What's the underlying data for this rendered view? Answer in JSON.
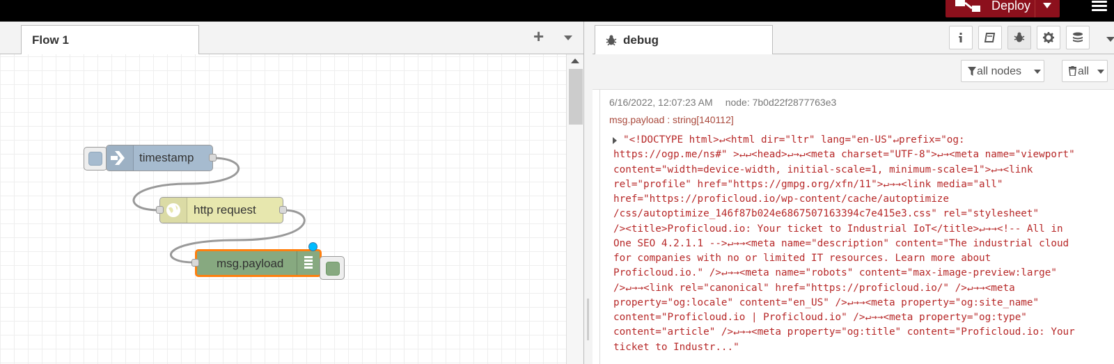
{
  "header": {
    "deploy_label": "Deploy",
    "brand_color": "#8c101c"
  },
  "workspace": {
    "tab_label": "Flow 1",
    "add_symbol": "+",
    "nodes": [
      {
        "label": "timestamp",
        "color": "#a6bbcf",
        "icon": "inject-arrow-icon"
      },
      {
        "label": "http request",
        "color": "#e7e7ae",
        "icon": "globe-icon"
      },
      {
        "label": "msg.payload",
        "color": "#87a980",
        "icon": "debug-list-icon"
      }
    ]
  },
  "sidebar": {
    "tab_label": "debug",
    "tab_icon": "bug-icon",
    "buttons": [
      "info-icon",
      "book-icon",
      "bug-icon",
      "gear-icon",
      "database-icon"
    ],
    "filter_label": "all nodes",
    "clear_label": "all"
  },
  "debug_message": {
    "timestamp": "6/16/2022, 12:07:23 AM",
    "node": "node: 7b0d22f2877763e3",
    "topic": "msg.payload : string[140112]",
    "body_lines": [
      "\"<!DOCTYPE html>↵<html dir=\"ltr\" lang=\"en-US\"↵prefix=\"og:",
      "https://ogp.me/ns#\" >↵↵<head>↵→↵<meta charset=\"UTF-8\">↵→<meta name=\"viewport\"",
      "content=\"width=device-width, initial-scale=1, minimum-scale=1\">↵→<link",
      "rel=\"profile\" href=\"https://gmpg.org/xfn/11\">↵→→<link media=\"all\"",
      "href=\"https://proficloud.io/wp-content/cache/autoptimize",
      "/css/autoptimize_146f87b024e6867507163394c7e415e3.css\" rel=\"stylesheet\"",
      "/><title>Proficloud.io: Your ticket to Industrial IoT</title>↵→→<!-- All in",
      "One SEO 4.2.1.1 -->↵→→<meta name=\"description\" content=\"The industrial cloud",
      "for companies with no or limited IT resources. Learn more about",
      "Proficloud.io.\" />↵→→<meta name=\"robots\" content=\"max-image-preview:large\"",
      "/>↵→→<link rel=\"canonical\" href=\"https://proficloud.io/\" />↵→→<meta",
      "property=\"og:locale\" content=\"en_US\" />↵→→<meta property=\"og:site_name\"",
      "content=\"Proficloud.io | Proficloud.io\" />↵→→<meta property=\"og:type\"",
      "content=\"article\" />↵→→<meta property=\"og:title\" content=\"Proficloud.io: Your",
      "ticket to Industr...\""
    ]
  }
}
